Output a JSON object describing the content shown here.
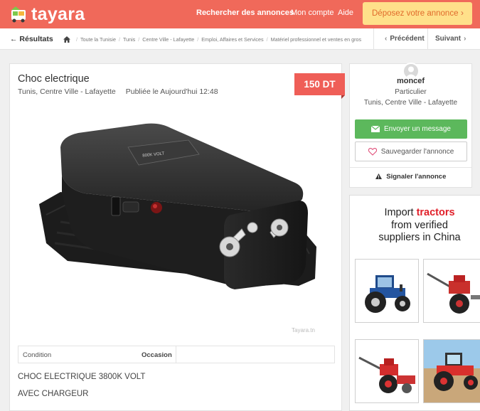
{
  "header": {
    "logo_text": "tayara",
    "nav_search": "Rechercher des annonces",
    "nav_account": "Mon compte",
    "nav_help": "Aide",
    "deposit_label": "Déposez votre annonce",
    "brand_color": "#f0695a"
  },
  "breadcrumb_bar": {
    "back_label": "Résultats",
    "crumbs": [
      "Toute la Tunisie",
      "Tunis",
      "Centre Ville - Lafayette",
      "Emploi, Affaires et Services",
      "Matériel professionnel et ventes en gros"
    ],
    "prev_label": "Précédent",
    "next_label": "Suivant"
  },
  "listing": {
    "title": "Choc electrique",
    "location": "Tunis, Centre Ville - Lafayette",
    "published": "Publiée le Aujourd'hui 12:48",
    "price": "150 DT",
    "attributes": [
      {
        "key": "Condition",
        "value": "Occasion"
      }
    ],
    "description_lines": [
      "CHOC ELECTRIQUE 3800K VOLT",
      "AVEC CHARGEUR"
    ],
    "photo_watermark": "Tayara.tn"
  },
  "seller": {
    "name": "moncef",
    "type": "Particulier",
    "location": "Tunis, Centre Ville - Lafayette",
    "message_label": "Envoyer un message",
    "save_label": "Sauvegarder l'annonce",
    "report_label": "Signaler l'annonce"
  },
  "ad": {
    "line1_prefix": "Import ",
    "line1_highlight": "tractors",
    "line2": "from verified",
    "line3": "suppliers in China"
  }
}
